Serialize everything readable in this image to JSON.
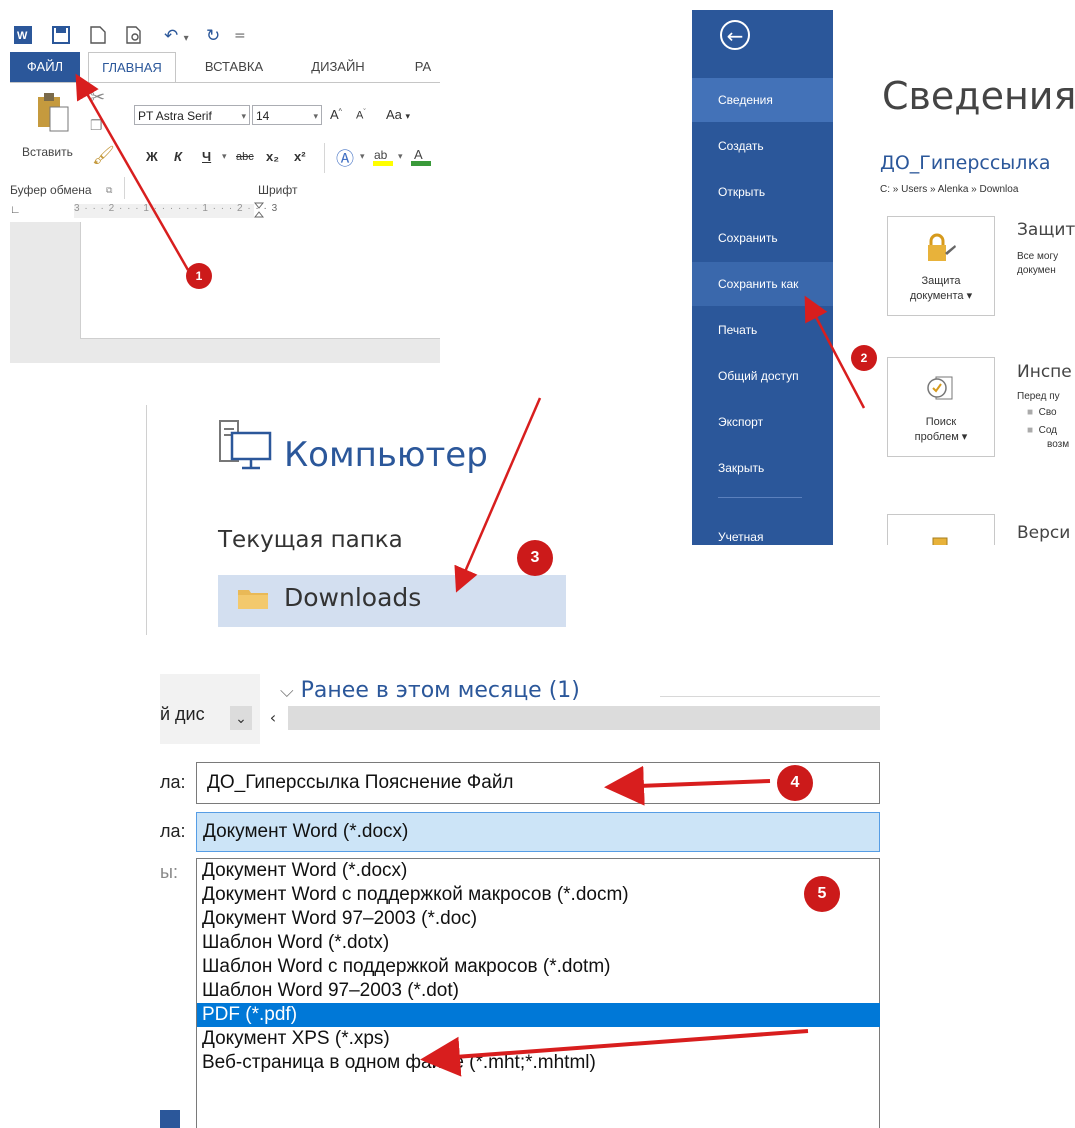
{
  "ribbon": {
    "tabs": [
      "ФАЙЛ",
      "ГЛАВНАЯ",
      "ВСТАВКА",
      "ДИЗАЙН",
      "РА"
    ],
    "paste_label": "Вставить",
    "font_name": "PT Astra Serif",
    "font_size": "14",
    "change_case": "Aa",
    "clipboard_group": "Буфер обмена",
    "font_group": "Шрифт",
    "format_buttons": [
      "Ж",
      "К",
      "Ч",
      "abc",
      "x₂",
      "x²"
    ],
    "ruler_text": "3 · · · 2 · · · 1 · · ·   · · · 1 · · · 2 · · · 3"
  },
  "backstage": {
    "nav": [
      "Сведения",
      "Создать",
      "Открыть",
      "Сохранить",
      "Сохранить как",
      "Печать",
      "Общий доступ",
      "Экспорт",
      "Закрыть",
      "Учетная"
    ],
    "title": "Сведения",
    "doc_name": "ДО_Гиперссылка",
    "path": "C: » Users » Alenka » Downloa",
    "protect": {
      "label": "Защита документа",
      "label_line1": "Защита",
      "label_line2": "документа ▾",
      "heading": "Защит",
      "text1": "Все могу",
      "text2": "докумен"
    },
    "inspect": {
      "label_line1": "Поиск",
      "label_line2": "проблем ▾",
      "heading": "Инспе",
      "text1": "Перед пу",
      "bullet1": "Сво",
      "bullet2": "Сод",
      "bullet3": "возм"
    },
    "versions": {
      "heading": "Верси"
    }
  },
  "computer": {
    "title": "Компьютер",
    "current_folder": "Текущая папка",
    "folder": "Downloads"
  },
  "save_dialog": {
    "group_header": "Ранее в этом месяце (1)",
    "drive_label": "й дис",
    "name_label_suffix": "ла:",
    "type_label_suffix": "ла:",
    "other_label_suffix": "ы:",
    "file_name": "ДО_Гиперссылка Пояснение Файл",
    "file_type": "Документ Word (*.docx)",
    "type_options": [
      "Документ Word (*.docx)",
      "Документ Word с поддержкой макросов (*.docm)",
      "Документ Word 97–2003 (*.doc)",
      "Шаблон Word (*.dotx)",
      "Шаблон Word с поддержкой макросов (*.dotm)",
      "Шаблон Word 97–2003 (*.dot)",
      "PDF (*.pdf)",
      "Документ XPS (*.xps)",
      "Веб-страница в одном файле (*.mht;*.mhtml)"
    ],
    "selected_option_index": 6
  },
  "steps": [
    "1",
    "2",
    "3",
    "4",
    "5"
  ],
  "colors": {
    "word_blue": "#2b579a",
    "badge_red": "#cc1a1a",
    "arrow_red": "#d81e1e",
    "selection_blue": "#0078d7"
  }
}
